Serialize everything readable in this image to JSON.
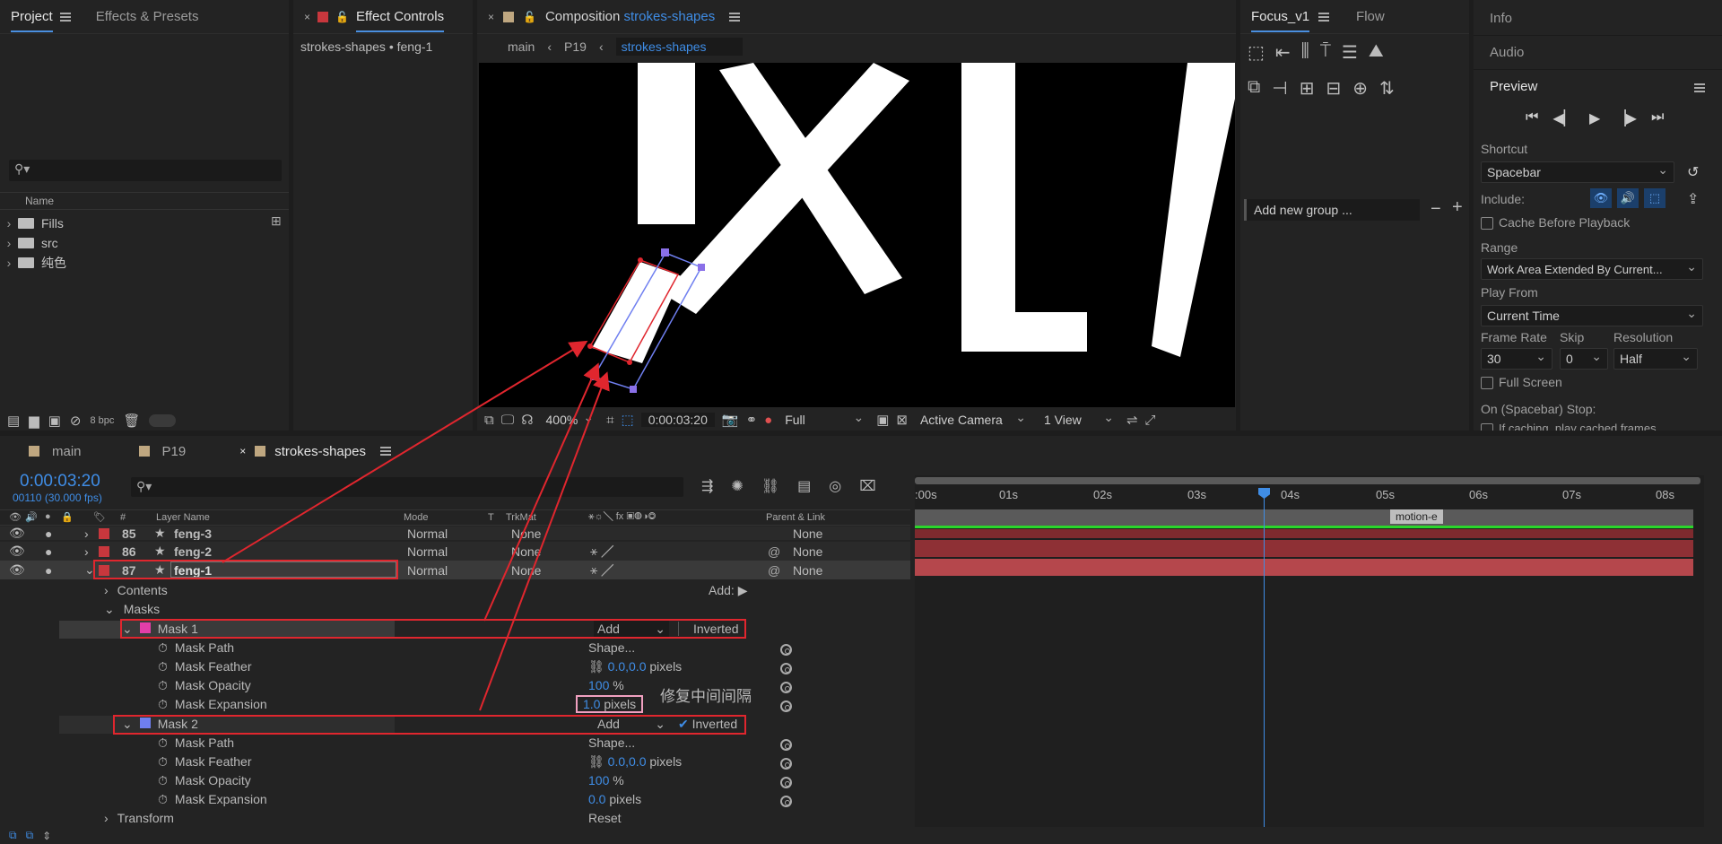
{
  "project_panel": {
    "tab_project": "Project",
    "tab_effects": "Effects & Presets",
    "column_name": "Name",
    "folders": [
      "Fills",
      "src",
      "纯色"
    ],
    "bpc": "8 bpc"
  },
  "effect_controls": {
    "tab_label": "Effect Controls",
    "subtitle": "strokes-shapes • feng-1"
  },
  "composition": {
    "tab_prefix": "Composition",
    "tab_name": "strokes-shapes",
    "breadcrumbs": [
      "main",
      "P19",
      "strokes-shapes"
    ],
    "zoom": "400%",
    "timecode": "0:00:03:20",
    "resolution": "Full",
    "camera": "Active Camera",
    "views": "1 View"
  },
  "focus_panel": {
    "tab_focus": "Focus_v1",
    "tab_flow": "Flow",
    "group_placeholder": "Add new group ..."
  },
  "right_panel": {
    "info": "Info",
    "audio": "Audio",
    "preview": "Preview",
    "shortcut_label": "Shortcut",
    "shortcut_value": "Spacebar",
    "include_label": "Include:",
    "cache_label": "Cache Before Playback",
    "range_label": "Range",
    "range_value": "Work Area Extended By Current...",
    "play_from_label": "Play From",
    "play_from_value": "Current Time",
    "frame_rate_label": "Frame Rate",
    "skip_label": "Skip",
    "resolution_label": "Resolution",
    "frame_rate_value": "30",
    "skip_value": "0",
    "resolution_value": "Half",
    "fullscreen_label": "Full Screen",
    "on_stop_label": "On (Spacebar) Stop:",
    "cached_label": "If caching, play cached frames"
  },
  "timeline": {
    "tabs": [
      "main",
      "P19",
      "strokes-shapes"
    ],
    "timecode": "0:00:03:20",
    "frame_info": "00110 (30.000 fps)",
    "col_hash": "#",
    "col_layer_name": "Layer Name",
    "col_mode": "Mode",
    "col_t": "T",
    "col_trkmat": "TrkMat",
    "col_parent": "Parent & Link",
    "layers": [
      {
        "num": "85",
        "name": "feng-3",
        "mode": "Normal",
        "trkmat": "None",
        "parent": "None"
      },
      {
        "num": "86",
        "name": "feng-2",
        "mode": "Normal",
        "trkmat": "None",
        "parent": "None"
      },
      {
        "num": "87",
        "name": "feng-1",
        "mode": "Normal",
        "trkmat": "None",
        "parent": "None"
      }
    ],
    "contents": "Contents",
    "add_label": "Add:",
    "masks": "Masks",
    "mask1": {
      "name": "Mask 1",
      "mode": "Add",
      "inverted": "Inverted",
      "path_label": "Mask Path",
      "path_value": "Shape...",
      "feather_label": "Mask Feather",
      "feather_value": "0.0,0.0",
      "feather_unit": "pixels",
      "opacity_label": "Mask Opacity",
      "opacity_value": "100",
      "opacity_unit": "%",
      "expansion_label": "Mask Expansion",
      "expansion_value": "1.0",
      "expansion_unit": "pixels"
    },
    "annotation": "修复中间间隔",
    "mask2": {
      "name": "Mask 2",
      "mode": "Add",
      "inverted": "Inverted",
      "path_label": "Mask Path",
      "path_value": "Shape...",
      "feather_label": "Mask Feather",
      "feather_value": "0.0,0.0",
      "feather_unit": "pixels",
      "opacity_label": "Mask Opacity",
      "opacity_value": "100",
      "opacity_unit": "%",
      "expansion_label": "Mask Expansion",
      "expansion_value": "0.0",
      "expansion_unit": "pixels"
    },
    "transform": "Transform",
    "reset": "Reset",
    "ruler": [
      ":00s",
      "01s",
      "02s",
      "03s",
      "04s",
      "05s",
      "06s",
      "07s",
      "08s"
    ],
    "marker": "motion-e"
  },
  "colors": {
    "accent": "#3f8de6",
    "annotation_red": "#e0262e",
    "layer_red": "#c8373d",
    "mask1": "#e23ea8",
    "mask2": "#6f7ff0"
  }
}
